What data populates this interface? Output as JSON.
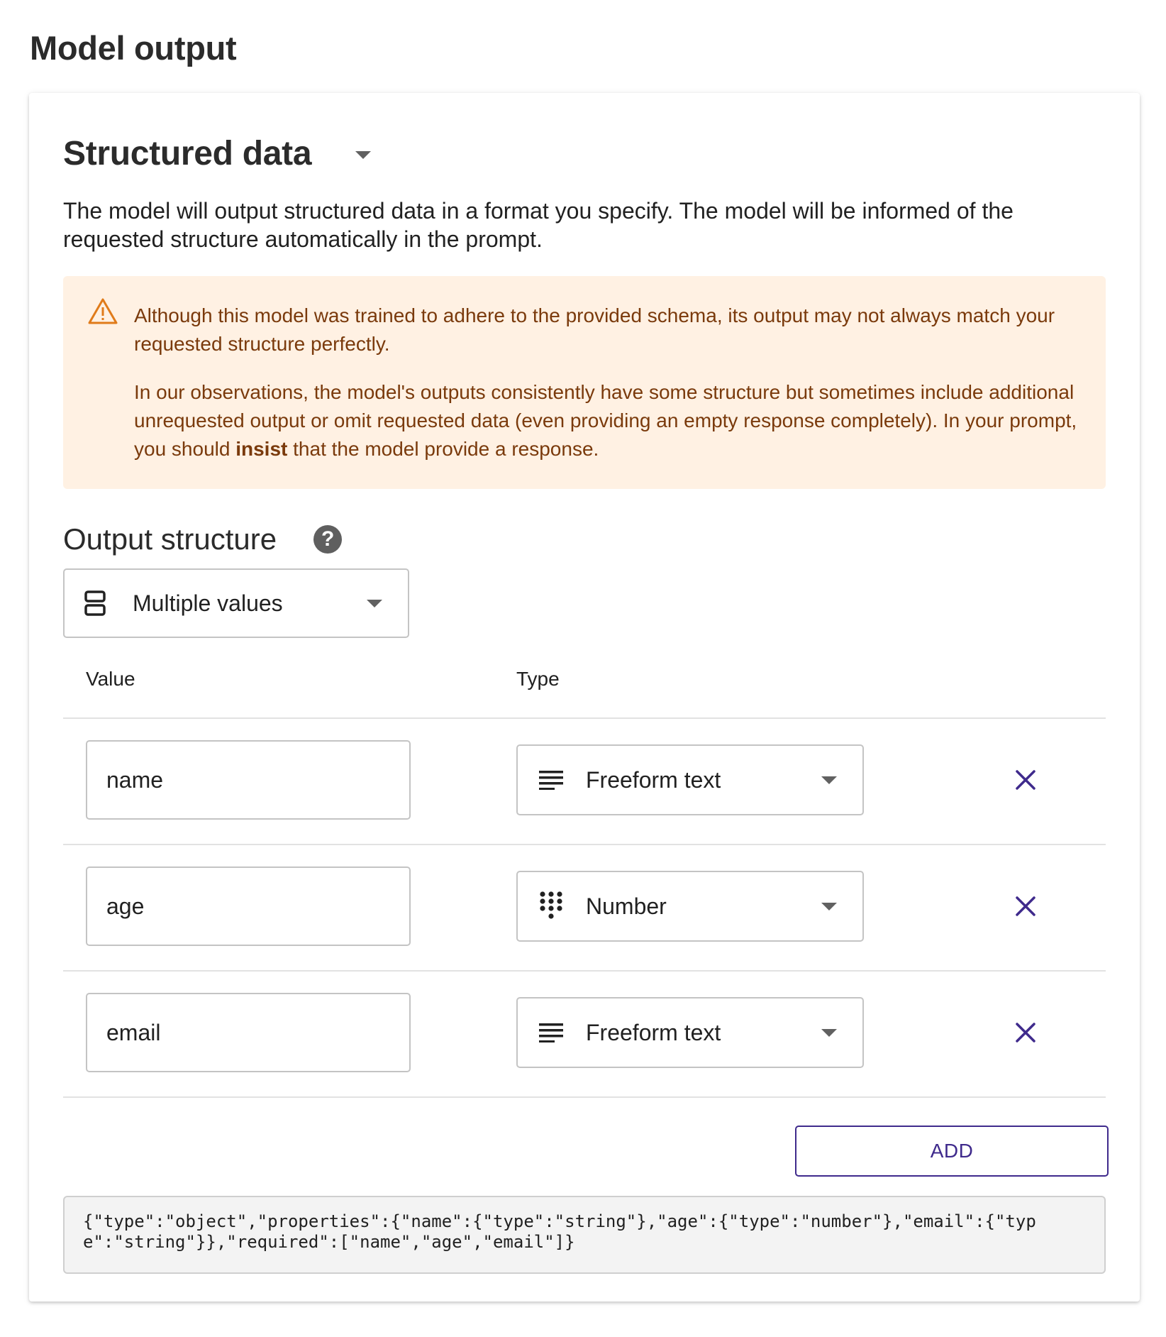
{
  "page": {
    "title": "Model output"
  },
  "section": {
    "title": "Structured data",
    "description": "The model will output structured data in a format you specify. The model will be informed of the requested structure automatically in the prompt."
  },
  "warning": {
    "icon": "warning-triangle-icon",
    "paragraph1": "Although this model was trained to adhere to the provided schema, its output may not always match your requested structure perfectly.",
    "paragraph2_before": "In our observations, the model's outputs consistently have some structure but sometimes include additional unrequested output or omit requested data (even providing an empty response completely). In your prompt, you should ",
    "paragraph2_bold": "insist",
    "paragraph2_after": " that the model provide a response.",
    "colors": {
      "background": "#fff1e3",
      "text": "#7a3a0c",
      "icon": "#e07b1a"
    }
  },
  "output_structure": {
    "label": "Output structure",
    "help_icon": "help-icon",
    "help_glyph": "?",
    "selected": "Multiple values",
    "selected_icon": "stacked-boxes-icon"
  },
  "table": {
    "columns": {
      "value": "Value",
      "type": "Type"
    },
    "rows": [
      {
        "value": "name",
        "type": "Freeform text",
        "type_icon": "text-lines-icon"
      },
      {
        "value": "age",
        "type": "Number",
        "type_icon": "dial-pad-icon"
      },
      {
        "value": "email",
        "type": "Freeform text",
        "type_icon": "text-lines-icon"
      }
    ],
    "remove_icon": "close-icon"
  },
  "add_button": {
    "label": "ADD"
  },
  "schema_preview": "{\"type\":\"object\",\"properties\":{\"name\":{\"type\":\"string\"},\"age\":{\"type\":\"number\"},\"email\":{\"type\":\"string\"}},\"required\":[\"name\",\"age\",\"email\"]}",
  "colors": {
    "accent": "#3f2a8c",
    "border": "#c4c4c4",
    "divider": "#e2e2e2"
  }
}
